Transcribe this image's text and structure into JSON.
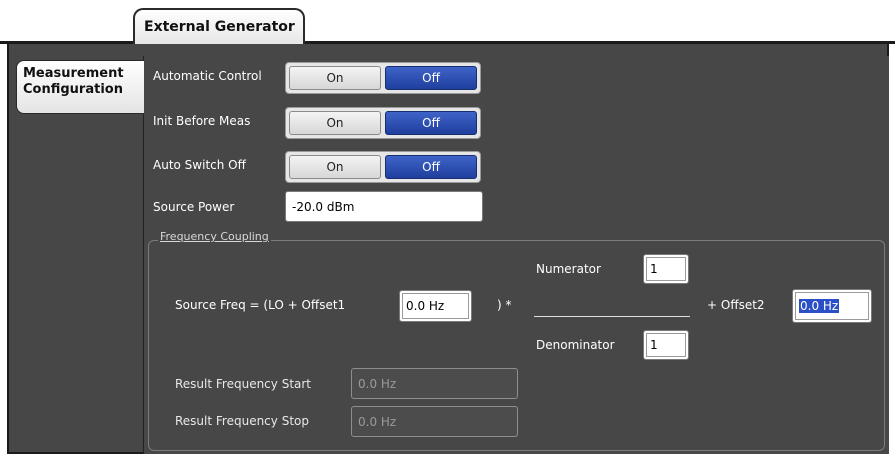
{
  "top_tab": {
    "label": "External Generator"
  },
  "side_tab": {
    "line1": "Measurement",
    "line2": "Configuration"
  },
  "rows": {
    "automatic_control": {
      "label": "Automatic Control",
      "on": "On",
      "off": "Off"
    },
    "init_before_meas": {
      "label": "Init Before Meas",
      "on": "On",
      "off": "Off"
    },
    "auto_switch_off": {
      "label": "Auto Switch Off",
      "on": "On",
      "off": "Off"
    },
    "source_power": {
      "label": "Source Power",
      "value": "-20.0 dBm"
    }
  },
  "frequency_coupling": {
    "legend": "Frequency Coupling",
    "formula_prefix": "Source Freq = (LO + Offset1",
    "offset1_value": "0.0 Hz",
    "paren_star": ") *",
    "numerator_label": "Numerator",
    "numerator_value": "1",
    "denominator_label": "Denominator",
    "denominator_value": "1",
    "offset2_label": "+ Offset2",
    "offset2_value": "0.0 Hz",
    "result_start_label": "Result Frequency Start",
    "result_start_value": "0.0 Hz",
    "result_stop_label": "Result Frequency Stop",
    "result_stop_value": "0.0 Hz"
  },
  "colors": {
    "panel": "#474747",
    "selected_blue": "#2b4fc6",
    "toggle_off_blue": "#1f3f9d"
  }
}
